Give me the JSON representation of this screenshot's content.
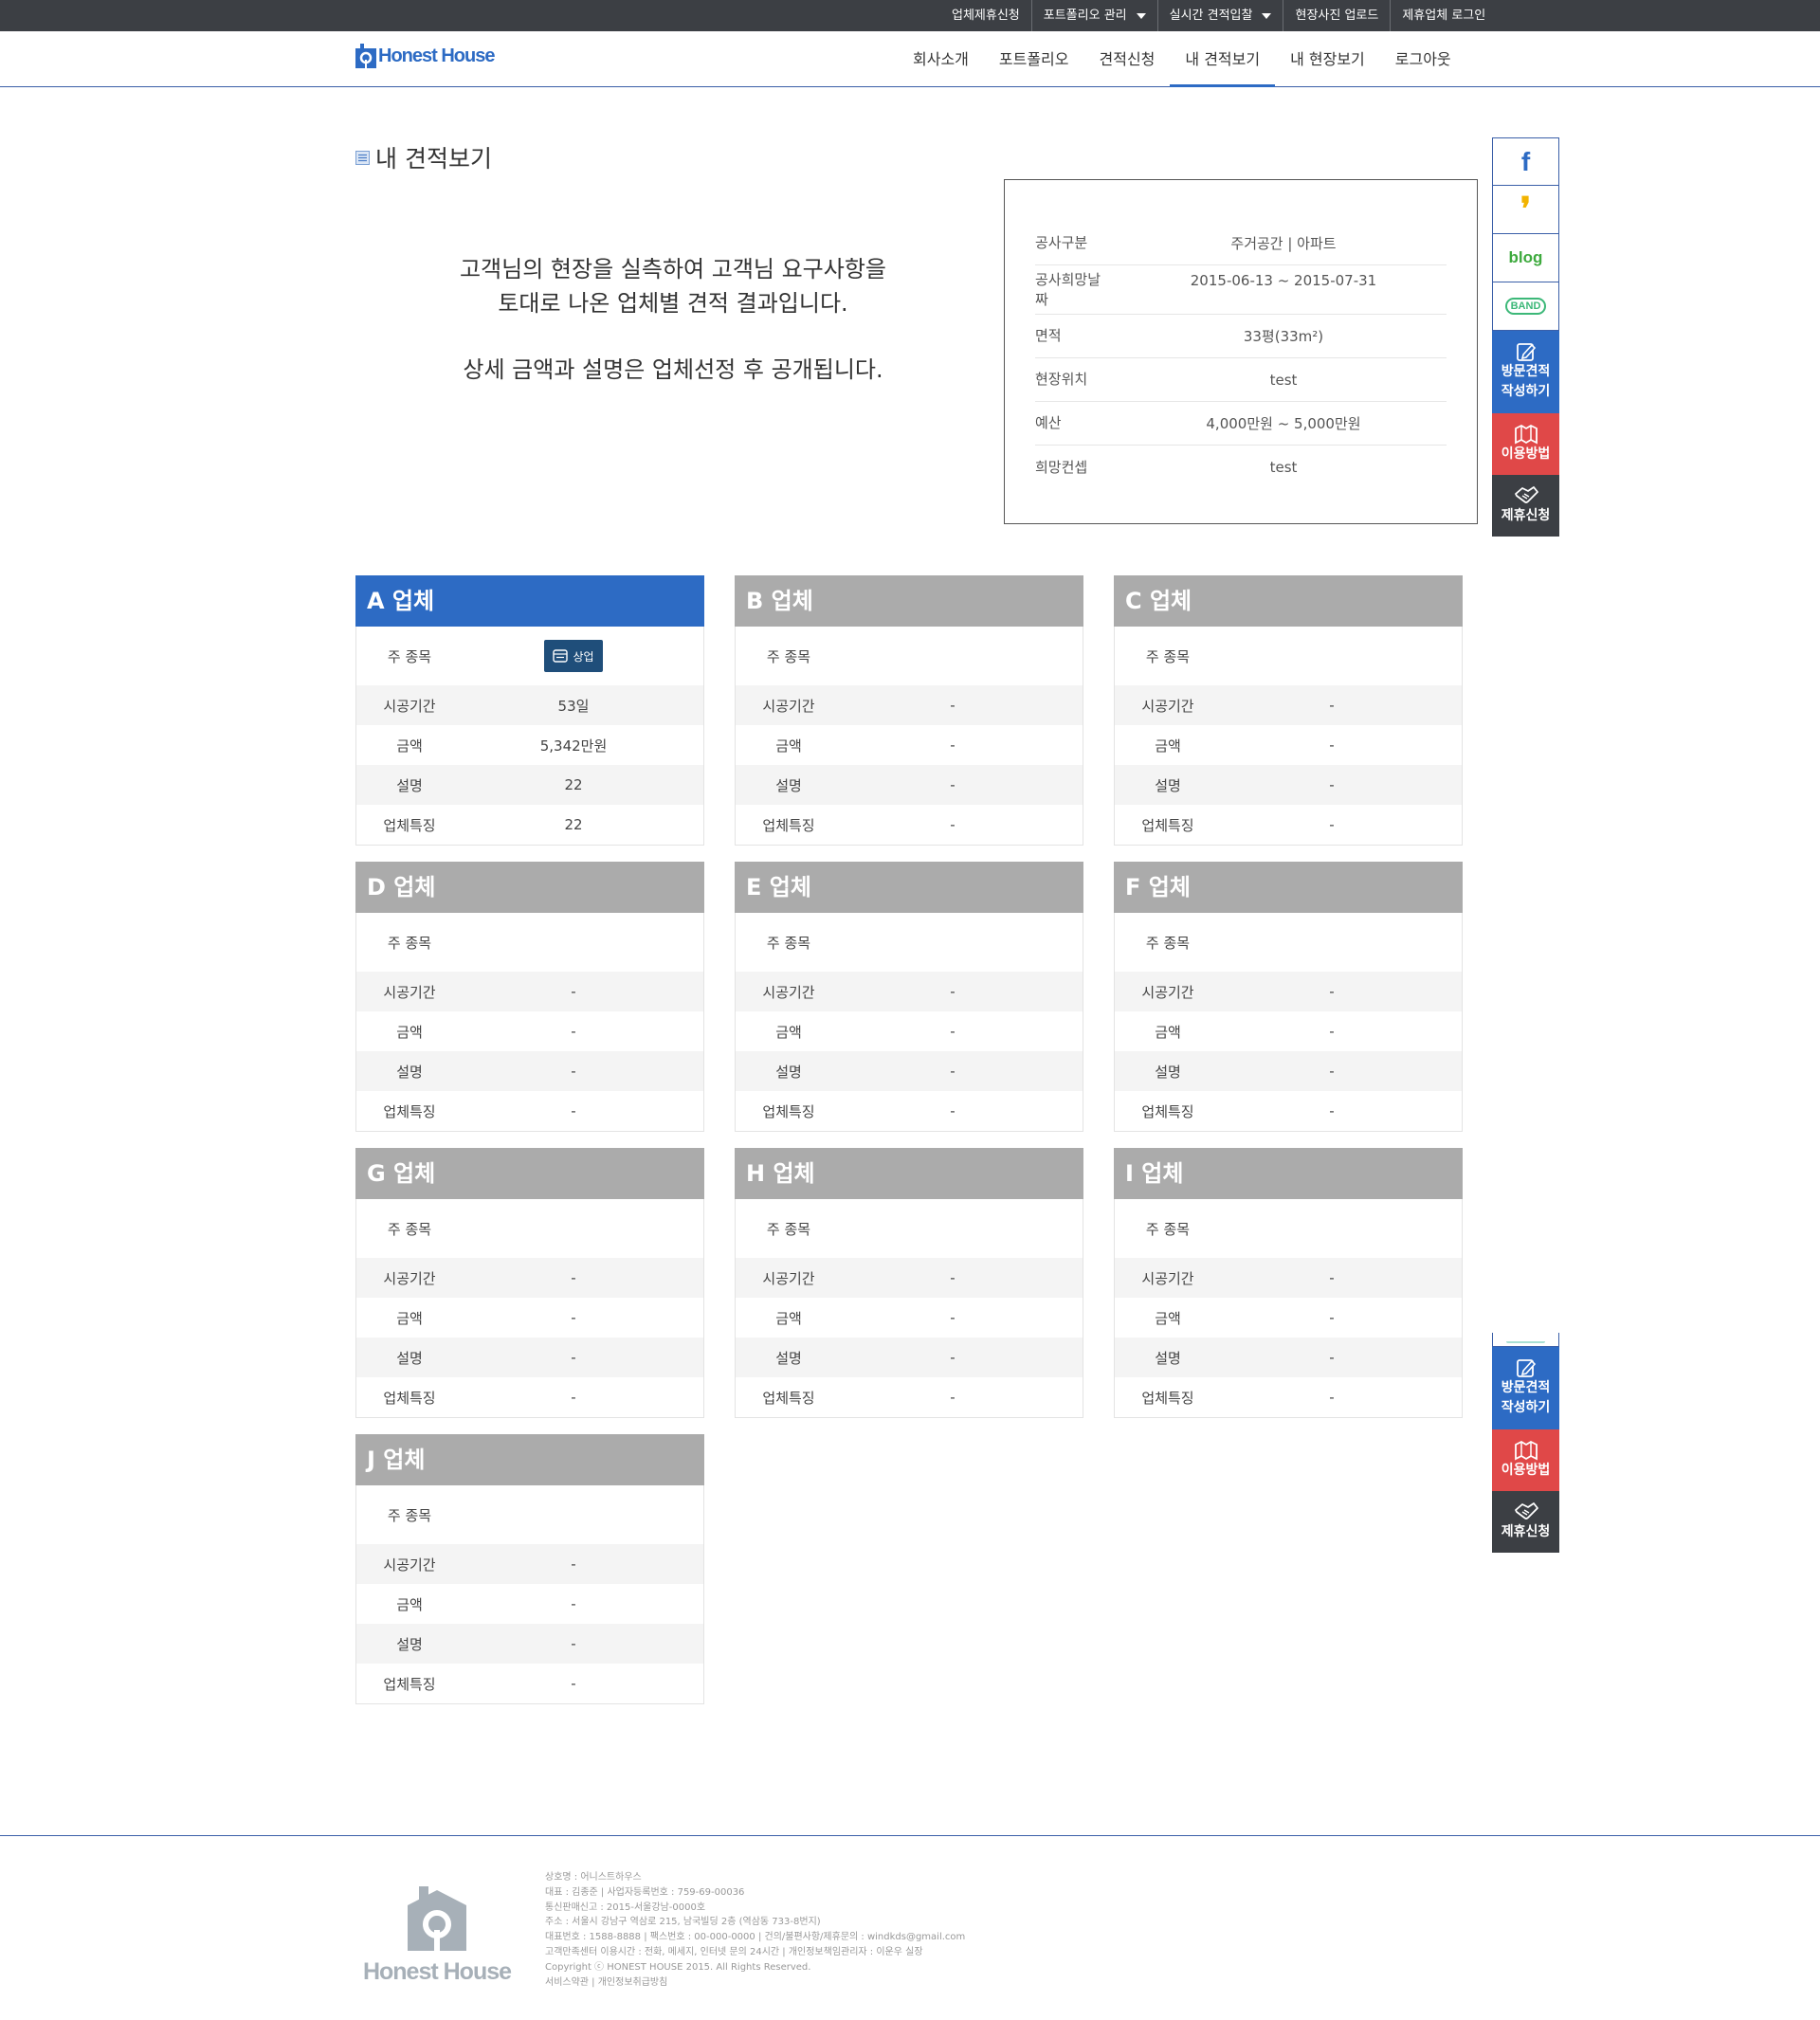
{
  "topbar": {
    "links": [
      {
        "label": "업체제휴신청",
        "dropdown": false
      },
      {
        "label": "포트폴리오 관리",
        "dropdown": true
      },
      {
        "label": "실시간 견적입찰",
        "dropdown": true
      },
      {
        "label": "현장사진 업로드",
        "dropdown": false
      },
      {
        "label": "제휴업체 로그인",
        "dropdown": false
      }
    ]
  },
  "header": {
    "logo": "Honest House",
    "nav": [
      "회사소개",
      "포트폴리오",
      "견적신청",
      "내 견적보기",
      "내 현장보기",
      "로그아웃"
    ],
    "active_nav": "내 견적보기"
  },
  "page": {
    "title": "내 견적보기",
    "intro_line1": "고객님의 현장을 실측하여 고객님 요구사항을",
    "intro_line2": "토대로 나온 업체별 견적 결과입니다.",
    "intro_line3": "상세 금액과 설명은 업체선정 후 공개됩니다."
  },
  "info": [
    {
      "label": "공사구분",
      "value": "주거공간 | 아파트"
    },
    {
      "label": "공사희망날짜",
      "value": "2015-06-13 ~ 2015-07-31"
    },
    {
      "label": "면적",
      "value": "33평(33m²)"
    },
    {
      "label": "현장위치",
      "value": "test"
    },
    {
      "label": "예산",
      "value": "4,000만원 ~ 5,000만원"
    },
    {
      "label": "희망컨셉",
      "value": "test"
    }
  ],
  "card_labels": {
    "main": "주 종목",
    "period": "시공기간",
    "amount": "금액",
    "desc": "설명",
    "feature": "업체특징"
  },
  "cards": [
    {
      "name": "A 업체",
      "selected": true,
      "main_badge": "상업",
      "period": "53일",
      "amount": "5,342만원",
      "desc": "22",
      "feature": "22"
    },
    {
      "name": "B 업체",
      "selected": false,
      "main_badge": "",
      "period": "-",
      "amount": "-",
      "desc": "-",
      "feature": "-"
    },
    {
      "name": "C 업체",
      "selected": false,
      "main_badge": "",
      "period": "-",
      "amount": "-",
      "desc": "-",
      "feature": "-"
    },
    {
      "name": "D 업체",
      "selected": false,
      "main_badge": "",
      "period": "-",
      "amount": "-",
      "desc": "-",
      "feature": "-"
    },
    {
      "name": "E 업체",
      "selected": false,
      "main_badge": "",
      "period": "-",
      "amount": "-",
      "desc": "-",
      "feature": "-"
    },
    {
      "name": "F 업체",
      "selected": false,
      "main_badge": "",
      "period": "-",
      "amount": "-",
      "desc": "-",
      "feature": "-"
    },
    {
      "name": "G 업체",
      "selected": false,
      "main_badge": "",
      "period": "-",
      "amount": "-",
      "desc": "-",
      "feature": "-"
    },
    {
      "name": "H 업체",
      "selected": false,
      "main_badge": "",
      "period": "-",
      "amount": "-",
      "desc": "-",
      "feature": "-"
    },
    {
      "name": "I 업체",
      "selected": false,
      "main_badge": "",
      "period": "-",
      "amount": "-",
      "desc": "-",
      "feature": "-"
    },
    {
      "name": "J 업체",
      "selected": false,
      "main_badge": "",
      "period": "-",
      "amount": "-",
      "desc": "-",
      "feature": "-"
    }
  ],
  "sidebar": {
    "facebook": "f",
    "kakao": "❜",
    "blog": "blog",
    "band": "BAND",
    "visit_estimate": [
      "방문견적",
      "작성하기"
    ],
    "how_to_use": "이용방법",
    "partnership": "제휴신청"
  },
  "footer": {
    "logo": "Honest House",
    "lines": [
      "상호명 : 어니스트하우스",
      "대표 : 김종준 | 사업자등록번호 : 759-69-00036",
      "통신판매신고 : 2015-서울강남-0000호",
      "주소 : 서울시 강남구 역삼로 215, 남국빌딩 2층 (역삼동 733-8번지)",
      "대표번호 : 1588-8888 | 팩스번호 : 00-000-0000 | 건의/불편사항/제휴문의 : windkds@gmail.com",
      "고객만족센터 이용시간 : 전화, 메세지, 인터넷 문의 24시간 | 개인정보책임관리자 : 이운우 실장",
      "Copyright ⓒ HONEST HOUSE 2015. All Rights Reserved.",
      "서비스약관 | 개인정보취급방침"
    ]
  },
  "colors": {
    "accent": "#2d6bc4",
    "topbar": "#3c3f44",
    "card_header_inactive": "#ababab",
    "red": "#e04848",
    "badge": "#1f4e7a"
  }
}
